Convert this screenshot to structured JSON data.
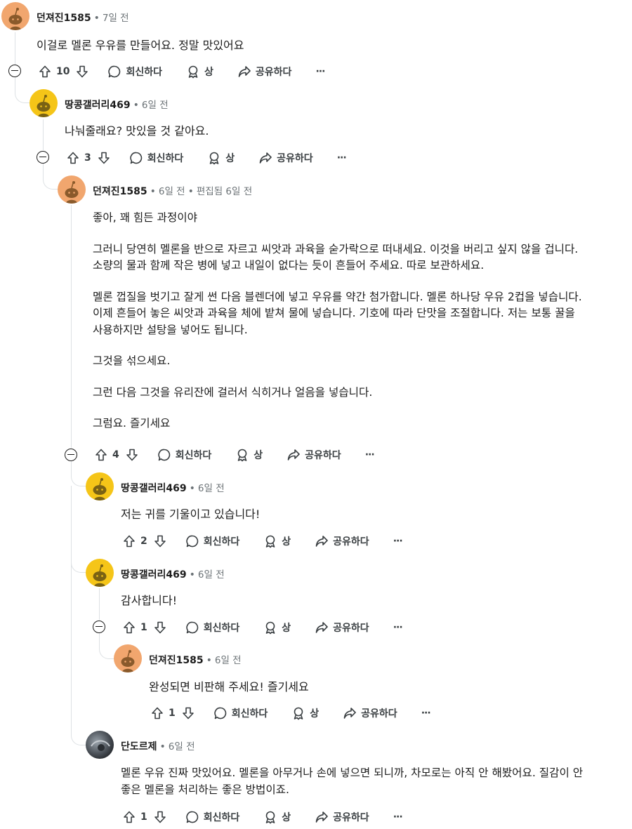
{
  "colors": {
    "text": "#1c1c1c",
    "meta": "#6b7276",
    "thread": "#dde1e4",
    "avatar_brown": "#f1a66e",
    "avatar_yellow": "#f5c518"
  },
  "labels": {
    "reply": "회신하다",
    "award": "상",
    "share": "공유하다",
    "more": "···",
    "dot": "•"
  },
  "comments": [
    {
      "author": "던져진1585",
      "time": "7일 전",
      "body": [
        "이걸로 멜론 우유를 만들어요. 정말 맛있어요"
      ],
      "votes": "10"
    },
    {
      "author": "땅콩갤러리469",
      "time": "6일 전",
      "body": [
        "나눠줄래요? 맛있을 것 같아요."
      ],
      "votes": "3"
    },
    {
      "author": "던져진1585",
      "time": "6일 전",
      "edited": "편집됨 6일 전",
      "body": [
        "좋아, 꽤 힘든 과정이야",
        "그러니 당연히 멜론을 반으로 자르고 씨앗과 과육을 숟가락으로 떠내세요. 이것을 버리고 싶지 않을 겁니다.",
        "소량의 물과 함께 작은 병에 넣고 내일이 없다는 듯이 흔들어 주세요. 따로 보관하세요.",
        "멜론 껍질을 벗기고 잘게 썬 다음 블렌더에 넣고 우유를 약간 첨가합니다. 멜론 하나당 우유 2컵을 넣습니다.",
        "이제 흔들어 놓은 씨앗과 과육을 체에 밭쳐 물에 넣습니다. 기호에 따라 단맛을 조절합니다. 저는 보통 꿀을",
        "사용하지만 설탕을 넣어도 됩니다.",
        "그것을 섞으세요.",
        "그런 다음 그것을 유리잔에 걸러서 식히거나 얼음을 넣습니다.",
        "그럼요. 즐기세요"
      ],
      "votes": "4"
    },
    {
      "author": "땅콩갤러리469",
      "time": "6일 전",
      "body": [
        "저는 귀를 기울이고 있습니다!"
      ],
      "votes": "2"
    },
    {
      "author": "땅콩갤러리469",
      "time": "6일 전",
      "body": [
        "감사합니다!"
      ],
      "votes": "1"
    },
    {
      "author": "던져진1585",
      "time": "6일 전",
      "body": [
        "완성되면 비판해 주세요! 즐기세요"
      ],
      "votes": "1"
    },
    {
      "author": "단도르제",
      "time": "6일 전",
      "body": [
        "멜론 우유 진짜 맛있어요. 멜론을 아무거나 손에 넣으면 되니까, 차모로는 아직 안 해봤어요. 질감이 안",
        "좋은 멜론을 처리하는 좋은 방법이죠."
      ],
      "votes": "1"
    }
  ]
}
